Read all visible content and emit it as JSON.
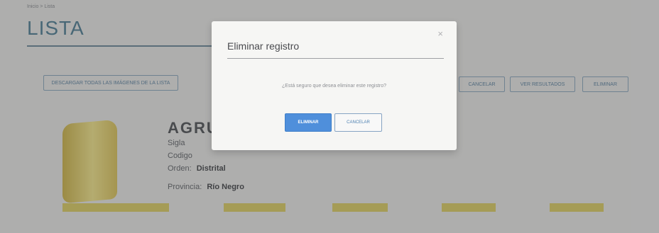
{
  "page": {
    "breadcrumb": "Inicio > Lista",
    "title": "LISTA",
    "toolbar": {
      "left_button": "DESCARGAR TODAS LAS IMÁGENES DE LA LISTA",
      "right_buttons": [
        "CANCELAR",
        "VER RESULTADOS",
        "ELIMINAR"
      ]
    },
    "card": {
      "name": "AGRUP",
      "sigla_label": "Sigla",
      "codigo_label": "Codigo",
      "orden_label": "Orden:",
      "orden_value": "Distrital",
      "provincia_label": "Provincia:",
      "provincia_value": "Río Negro"
    }
  },
  "modal": {
    "title": "Eliminar registro",
    "close_glyph": "×",
    "message": "¿Está seguro que desea eliminar este registro?",
    "confirm_button": "ELIMINAR",
    "cancel_button": "CANCELAR"
  },
  "colors": {
    "accent": "#4f8fdb",
    "title_blue": "#3c6f86",
    "stripe_yellow": "#d8c751"
  }
}
